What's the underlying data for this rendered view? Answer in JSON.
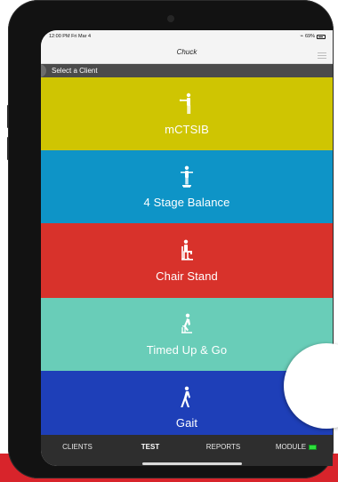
{
  "status": {
    "time_date": "12:00 PM  Fri Mar 4",
    "battery_text": "69%"
  },
  "header": {
    "title": "Chuck"
  },
  "client_bar": {
    "label": "Select a Client"
  },
  "tests": [
    {
      "label": "mCTSIB",
      "color": "#cfc502",
      "icon": "mctsib-icon"
    },
    {
      "label": "4 Stage Balance",
      "color": "#0e94c7",
      "icon": "balance-icon"
    },
    {
      "label": "Chair Stand",
      "color": "#d8322b",
      "icon": "chair-stand-icon"
    },
    {
      "label": "Timed Up & Go",
      "color": "#69cdb8",
      "icon": "timed-up-go-icon"
    },
    {
      "label": "Gait",
      "color": "#1e3fb8",
      "icon": "gait-icon"
    }
  ],
  "tabs": [
    {
      "label": "CLIENTS",
      "active": false
    },
    {
      "label": "TEST",
      "active": true
    },
    {
      "label": "REPORTS",
      "active": false
    },
    {
      "label": "MODULE",
      "active": false
    }
  ],
  "colors": {
    "brand_red": "#d8242b",
    "device_frame": "#121212",
    "tab_bar": "#2e2e2e"
  }
}
